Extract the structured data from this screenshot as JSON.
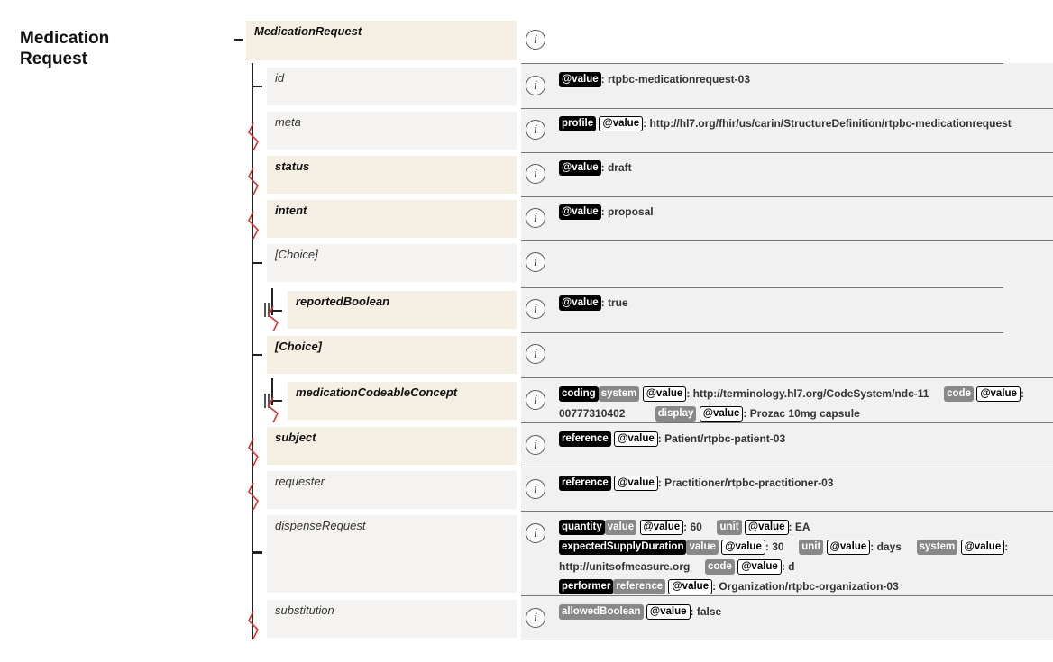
{
  "title_line1": "Medication",
  "title_line2": "Request",
  "root": "MedicationRequest",
  "rows": [
    {
      "name": "id"
    },
    {
      "name": "meta"
    },
    {
      "name": "status"
    },
    {
      "name": "intent"
    },
    {
      "name": "[Choice]"
    },
    {
      "name": "reportedBoolean"
    },
    {
      "name": "[Choice]"
    },
    {
      "name": "medicationCodeableConcept"
    },
    {
      "name": "subject"
    },
    {
      "name": "requester"
    },
    {
      "name": "dispenseRequest"
    },
    {
      "name": "substitution"
    }
  ],
  "info_glyph": "i",
  "labels": {
    "value": "@value",
    "profile": "profile",
    "coding": "coding",
    "system": "system",
    "code": "code",
    "display": "display",
    "reference": "reference",
    "quantity": "quantity",
    "value_plain": "value",
    "unit": "unit",
    "expectedSupplyDuration": "expectedSupplyDuration",
    "performer": "performer",
    "allowedBoolean": "allowedBoolean"
  },
  "values": {
    "id": ": rtpbc-medicationrequest-03",
    "meta": ": http://hl7.org/fhir/us/carin/StructureDefinition/rtpbc-medicationrequest",
    "status": ": draft",
    "intent": ": proposal",
    "reported": ": true",
    "med_system": ": http://terminology.hl7.org/CodeSystem/ndc-11",
    "med_code_colon": ":",
    "med_code": "00777310402",
    "med_display": ": Prozac 10mg capsule",
    "subject": ": Patient/rtpbc-patient-03",
    "requester": ": Practitioner/rtpbc-practitioner-03",
    "qty_value": ": 60",
    "qty_unit": ": EA",
    "dur_value": ": 30",
    "dur_unit": ": days",
    "dur_system_colon": ":",
    "dur_system": "http://unitsofmeasure.org",
    "dur_code": ": d",
    "performer": ": Organization/rtpbc-organization-03",
    "allowed": ": false"
  }
}
